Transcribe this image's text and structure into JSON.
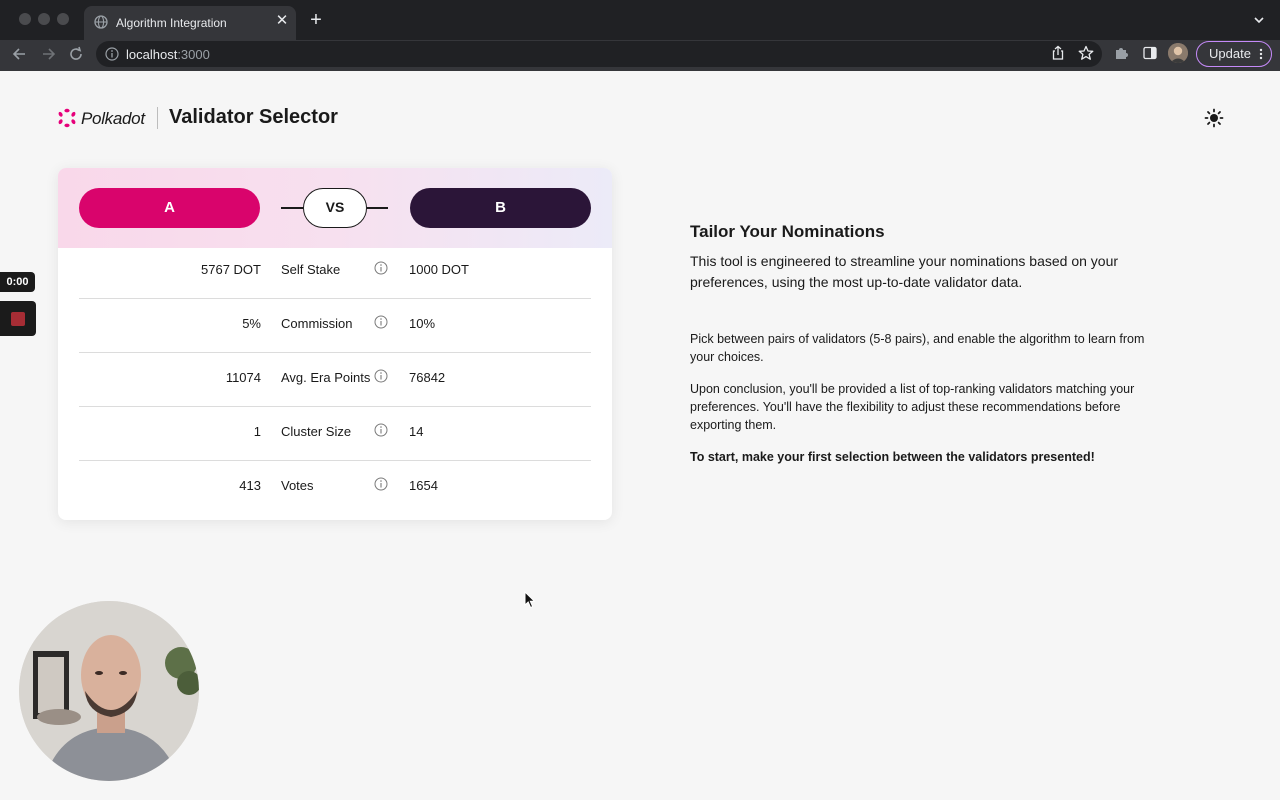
{
  "browser": {
    "tab_title": "Algorithm Integration",
    "url_host": "localhost",
    "url_port": ":3000",
    "update_label": "Update"
  },
  "header": {
    "brand": "Polkadot",
    "title": "Validator Selector",
    "brand_color": "#e6007a"
  },
  "compare": {
    "option_a": "A",
    "option_b": "B",
    "vs": "VS",
    "rows": [
      {
        "a": "5767 DOT",
        "metric": "Self Stake",
        "b": "1000 DOT"
      },
      {
        "a": "5%",
        "metric": "Commission",
        "b": "10%"
      },
      {
        "a": "11074",
        "metric": "Avg. Era Points",
        "b": "76842"
      },
      {
        "a": "1",
        "metric": "Cluster Size",
        "b": "14"
      },
      {
        "a": "413",
        "metric": "Votes",
        "b": "1654"
      }
    ],
    "colors": {
      "a": "#d9046c",
      "b": "#2b1538"
    }
  },
  "intro": {
    "title": "Tailor Your Nominations",
    "lead": "This tool is engineered to streamline your nominations based on your preferences, using the most up-to-date validator data.",
    "p1": "Pick between pairs of validators (5-8 pairs), and enable the algorithm to learn from your choices.",
    "p2": "Upon conclusion, you'll be provided a list of top-ranking validators matching your preferences. You'll have the flexibility to adjust these recommendations before exporting them.",
    "cta": "To start, make your first selection between the validators presented!"
  },
  "recorder": {
    "time": "0:00"
  }
}
